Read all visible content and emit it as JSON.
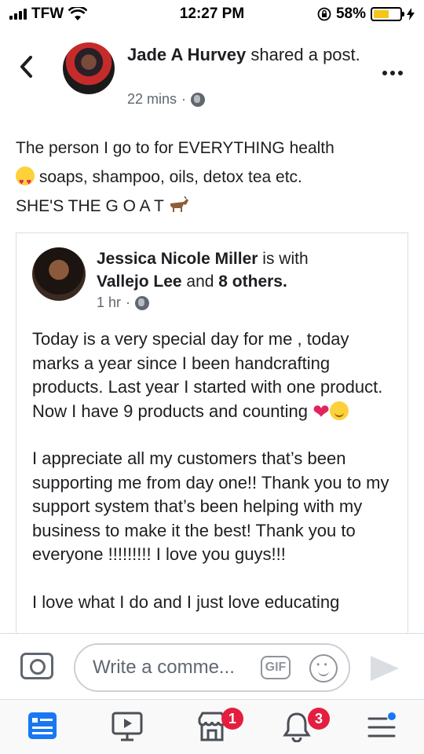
{
  "status_bar": {
    "carrier": "TFW",
    "time": "12:27 PM",
    "battery": "58%",
    "battery_level": 0.58
  },
  "header": {
    "author": "Jade A Hurvey",
    "action": "shared a post.",
    "time": "22 mins",
    "separator": "·"
  },
  "post": {
    "line1": "The person I go to for EVERYTHING health",
    "line2": "soaps, shampoo, oils, detox tea etc.",
    "line3": "SHE'S THE G O A T"
  },
  "shared": {
    "author": "Jessica Nicole Miller",
    "is_with": "is with",
    "tagged": "Vallejo Lee",
    "and": "and",
    "others": "8 others.",
    "time": "1 hr",
    "separator": "·",
    "paragraph1": "Today is a very special day for me , today marks a year since I been handcrafting products. Last year I started with one product. Now I have 9 products and counting",
    "paragraph2": "I appreciate all my customers that’s been supporting me from day one!! Thank you to my support system that’s been helping with my business to make it the best! Thank you to everyone !!!!!!!!! I love you guys!!!",
    "paragraph3": "I love what I do and I just love educating"
  },
  "comment_bar": {
    "placeholder": "Write a comme...",
    "gif_label": "GIF"
  },
  "tabs": {
    "marketplace_badge": "1",
    "notifications_badge": "3"
  },
  "colors": {
    "badge": "#e41e3f",
    "active_tab": "#1877f2",
    "muted": "#606770"
  }
}
